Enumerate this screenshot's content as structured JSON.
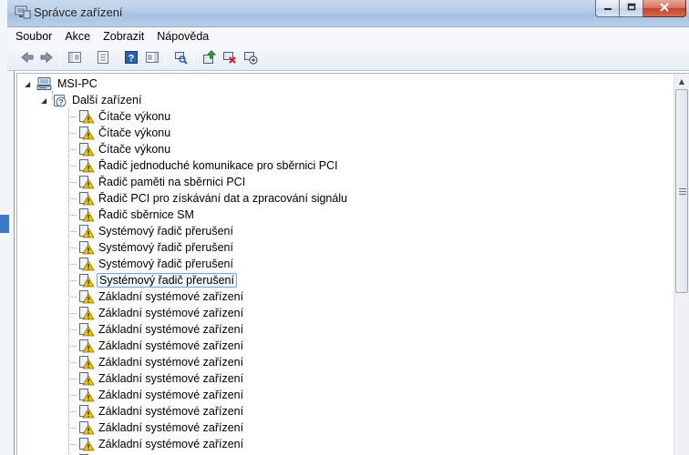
{
  "window": {
    "title": "Správce zařízení"
  },
  "menu": [
    "Soubor",
    "Akce",
    "Zobrazit",
    "Nápověda"
  ],
  "toolbar": {
    "icons": [
      "back-icon",
      "forward-icon",
      "show-hide-console-tree-icon",
      "properties-icon",
      "help-icon",
      "action-pane-icon",
      "scan-hardware-icon",
      "update-driver-icon",
      "uninstall-icon",
      "disable-device-icon"
    ]
  },
  "tree": {
    "root": "MSI-PC",
    "category": "Další zařízení",
    "devices": [
      "Čítače výkonu",
      "Čítače výkonu",
      "Čítače výkonu",
      "Řadič jednoduché komunikace pro sběrnici PCI",
      "Řadič paměti na sběrnici PCI",
      "Řadič PCI pro získávání dat a zpracování signálu",
      "Řadič sběrnice SM",
      "Systémový řadič přerušení",
      "Systémový řadič přerušení",
      "Systémový řadič přerušení",
      "Systémový řadič přerušení",
      "Základní systémové zařízení",
      "Základní systémové zařízení",
      "Základní systémové zařízení",
      "Základní systémové zařízení",
      "Základní systémové zařízení",
      "Základní systémové zařízení",
      "Základní systémové zařízení",
      "Základní systémové zařízení",
      "Základní systémové zařízení",
      "Základní systémové zařízení",
      "Základní systémové zařízení"
    ],
    "selected_index": 10
  },
  "colors": {
    "titlebar": "#b4cbe6",
    "close_button": "#c75050",
    "warning_icon": "#f2c300",
    "selection_border": "#7da2ce"
  }
}
